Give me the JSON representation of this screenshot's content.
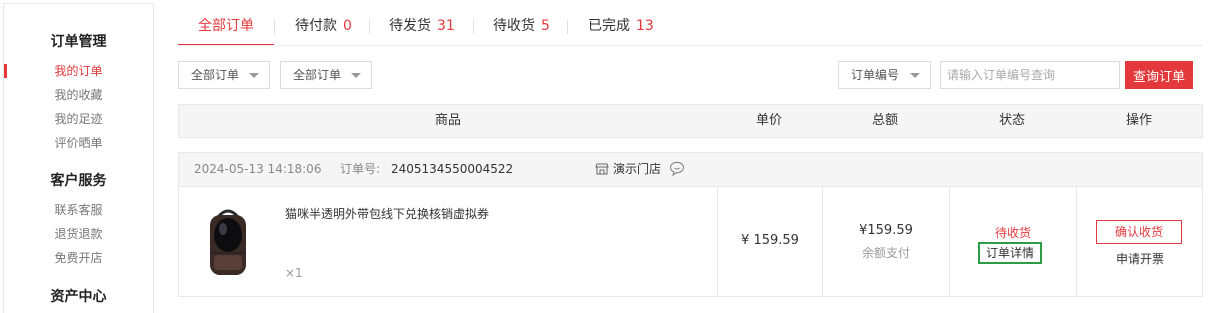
{
  "sidebar": {
    "groups": [
      {
        "title": "订单管理",
        "items": [
          "我的订单",
          "我的收藏",
          "我的足迹",
          "评价晒单"
        ]
      },
      {
        "title": "客户服务",
        "items": [
          "联系客服",
          "退货退款",
          "免费开店"
        ]
      },
      {
        "title": "资产中心",
        "items": []
      }
    ]
  },
  "tabs": [
    {
      "label": "全部订单",
      "count": ""
    },
    {
      "label": "待付款",
      "count": "0"
    },
    {
      "label": "待发货",
      "count": "31"
    },
    {
      "label": "待收货",
      "count": "5"
    },
    {
      "label": "已完成",
      "count": "13"
    }
  ],
  "filters": {
    "filter1": "全部订单",
    "filter2": "全部订单",
    "search_type": "订单编号",
    "search_placeholder": "请输入订单编号查询",
    "search_button": "查询订单"
  },
  "table_header": {
    "product": "商品",
    "unit_price": "单价",
    "total": "总额",
    "status": "状态",
    "action": "操作"
  },
  "order": {
    "datetime": "2024-05-13 14:18:06",
    "order_no_label": "订单号:",
    "order_no": "2405134550004522",
    "store": "演示门店",
    "product_title": "猫咪半透明外带包线下兑换核销虚拟券",
    "quantity": "×1",
    "unit_price": "¥ 159.59",
    "total_price": "¥159.59",
    "payment_method": "余额支付",
    "status": "待收货",
    "detail_button": "订单详情",
    "confirm_button": "确认收货",
    "invoice_link": "申请开票"
  },
  "colors": {
    "accent": "#e4393c",
    "detail_border": "#2e9b47"
  }
}
